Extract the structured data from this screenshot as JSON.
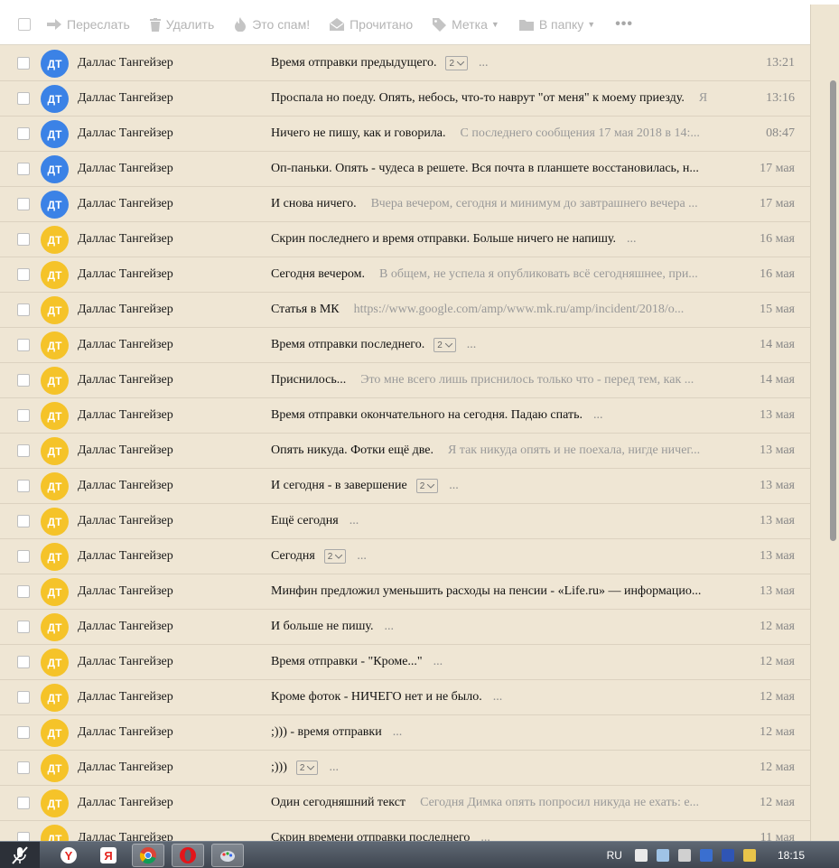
{
  "toolbar": {
    "forward": "Переслать",
    "delete": "Удалить",
    "spam": "Это спам!",
    "read": "Прочитано",
    "label": "Метка",
    "folder": "В папку",
    "more": "•••"
  },
  "colors": {
    "avatar_blue": "#3b82e6",
    "avatar_yellow": "#f5c329",
    "background": "#efe6d4"
  },
  "emails": [
    {
      "initials": "ДТ",
      "color": "blue",
      "sender": "Даллас Тангейзер",
      "subject": "Время отправки предыдущего.",
      "count": "2",
      "preview": "",
      "date": "13:21"
    },
    {
      "initials": "ДТ",
      "color": "blue",
      "sender": "Даллас Тангейзер",
      "subject": "Проспала но поеду. Опять, небось, что-то наврут \"от меня\" к моему приезду.",
      "count": "",
      "preview": "Я",
      "date": "13:16"
    },
    {
      "initials": "ДТ",
      "color": "blue",
      "sender": "Даллас Тангейзер",
      "subject": "Ничего не пишу, как и говорила.",
      "count": "",
      "preview": "С последнего сообщения 17 мая 2018 в 14:...",
      "date": "08:47"
    },
    {
      "initials": "ДТ",
      "color": "blue",
      "sender": "Даллас Тангейзер",
      "subject": "Оп-паньки. Опять - чудеса в решете. Вся почта в планшете восстановилась, н...",
      "count": "",
      "preview": "",
      "date": "17 мая"
    },
    {
      "initials": "ДТ",
      "color": "blue",
      "sender": "Даллас Тангейзер",
      "subject": "И снова ничего.",
      "count": "",
      "preview": "Вчера вечером, сегодня и минимум до завтрашнего вечера ...",
      "date": "17 мая"
    },
    {
      "initials": "ДТ",
      "color": "yellow",
      "sender": "Даллас Тангейзер",
      "subject": "Скрин последнего и время отправки. Больше ничего не напишу.",
      "count": "",
      "preview": "",
      "date": "16 мая"
    },
    {
      "initials": "ДТ",
      "color": "yellow",
      "sender": "Даллас Тангейзер",
      "subject": "Сегодня вечером.",
      "count": "",
      "preview": "В общем, не успела я опубликовать всё сегодняшнее, при...",
      "date": "16 мая"
    },
    {
      "initials": "ДТ",
      "color": "yellow",
      "sender": "Даллас Тангейзер",
      "subject": "Статья в МК",
      "count": "",
      "preview": "https://www.google.com/amp/www.mk.ru/amp/incident/2018/o...",
      "date": "15 мая"
    },
    {
      "initials": "ДТ",
      "color": "yellow",
      "sender": "Даллас Тангейзер",
      "subject": "Время отправки последнего.",
      "count": "2",
      "preview": "",
      "date": "14 мая"
    },
    {
      "initials": "ДТ",
      "color": "yellow",
      "sender": "Даллас Тангейзер",
      "subject": "Приснилось...",
      "count": "",
      "preview": "Это мне всего лишь приснилось только что - перед тем, как ...",
      "date": "14 мая"
    },
    {
      "initials": "ДТ",
      "color": "yellow",
      "sender": "Даллас Тангейзер",
      "subject": "Время отправки окончательного на сегодня. Падаю спать.",
      "count": "",
      "preview": "",
      "date": "13 мая"
    },
    {
      "initials": "ДТ",
      "color": "yellow",
      "sender": "Даллас Тангейзер",
      "subject": "Опять никуда. Фотки ещё две.",
      "count": "",
      "preview": "Я так никуда опять и не поехала, нигде ничег...",
      "date": "13 мая"
    },
    {
      "initials": "ДТ",
      "color": "yellow",
      "sender": "Даллас Тангейзер",
      "subject": "И сегодня - в завершение",
      "count": "2",
      "preview": "",
      "date": "13 мая"
    },
    {
      "initials": "ДТ",
      "color": "yellow",
      "sender": "Даллас Тангейзер",
      "subject": "Ещё сегодня",
      "count": "",
      "preview": "",
      "date": "13 мая"
    },
    {
      "initials": "ДТ",
      "color": "yellow",
      "sender": "Даллас Тангейзер",
      "subject": "Сегодня",
      "count": "2",
      "preview": "",
      "date": "13 мая"
    },
    {
      "initials": "ДТ",
      "color": "yellow",
      "sender": "Даллас Тангейзер",
      "subject": "Минфин предложил уменьшить расходы на пенсии - «Life.ru» — информацио...",
      "count": "",
      "preview": "",
      "date": "13 мая"
    },
    {
      "initials": "ДТ",
      "color": "yellow",
      "sender": "Даллас Тангейзер",
      "subject": "И больше не пишу.",
      "count": "",
      "preview": "",
      "date": "12 мая"
    },
    {
      "initials": "ДТ",
      "color": "yellow",
      "sender": "Даллас Тангейзер",
      "subject": "Время отправки - \"Кроме...\"",
      "count": "",
      "preview": "",
      "date": "12 мая"
    },
    {
      "initials": "ДТ",
      "color": "yellow",
      "sender": "Даллас Тангейзер",
      "subject": "Кроме фоток - НИЧЕГО нет и не было.",
      "count": "",
      "preview": "",
      "date": "12 мая"
    },
    {
      "initials": "ДТ",
      "color": "yellow",
      "sender": "Даллас Тангейзер",
      "subject": ";))) - время отправки",
      "count": "",
      "preview": "",
      "date": "12 мая"
    },
    {
      "initials": "ДТ",
      "color": "yellow",
      "sender": "Даллас Тангейзер",
      "subject": ";)))",
      "count": "2",
      "preview": "",
      "date": "12 мая"
    },
    {
      "initials": "ДТ",
      "color": "yellow",
      "sender": "Даллас Тангейзер",
      "subject": "Один сегодняшний текст",
      "count": "",
      "preview": "Сегодня Димка опять попросил никуда не ехать: е...",
      "date": "12 мая"
    },
    {
      "initials": "ДТ",
      "color": "yellow",
      "sender": "Даллас Тангейзер",
      "subject": "Скрин времени отправки последнего",
      "count": "",
      "preview": "",
      "date": "11 мая"
    }
  ],
  "taskbar": {
    "lang": "RU",
    "clock": "18:15",
    "apps": [
      "yandex-browser",
      "yandex",
      "chrome",
      "opera",
      "paint"
    ]
  }
}
